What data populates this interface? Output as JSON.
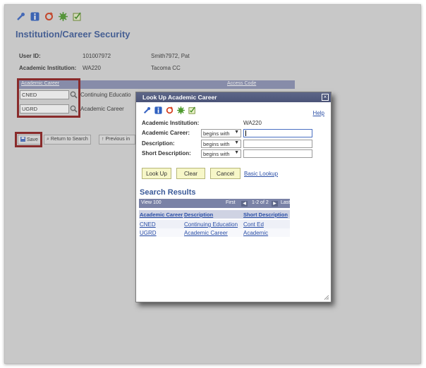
{
  "page": {
    "title": "Institution/Career Security",
    "user_id_label": "User ID:",
    "user_id_value": "101007972",
    "user_name": "Smith7972, Pat",
    "institution_label": "Academic Institution:",
    "institution_value": "WA220",
    "institution_name": "Tacoma CC"
  },
  "grid": {
    "col_academic_career": "Academic Career",
    "col_access_code": "Access Code",
    "rows": [
      {
        "code": "CNED",
        "desc": "Continuing Educatio"
      },
      {
        "code": "UGRD",
        "desc": "Academic Career"
      }
    ]
  },
  "buttons": {
    "save": "Save",
    "return_to_search": "Return to Search",
    "previous": "Previous in"
  },
  "modal": {
    "title": "Look Up Academic Career",
    "help": "Help",
    "institution_label": "Academic Institution:",
    "institution_value": "WA220",
    "career_label": "Academic Career:",
    "description_label": "Description:",
    "short_description_label": "Short Description:",
    "operator": "begins with",
    "lookup_button": "Look Up",
    "clear_button": "Clear",
    "cancel_button": "Cancel",
    "basic_lookup": "Basic Lookup",
    "search_results_title": "Search Results",
    "view_100": "View 100",
    "first": "First",
    "page_range": "1-2 of 2",
    "last": "Last",
    "col_career": "Academic Career",
    "col_description": "Description",
    "col_short_description": "Short Description",
    "results": [
      {
        "career": "CNED",
        "description": "Continuing Education",
        "short": "Cont Ed"
      },
      {
        "career": "UGRD",
        "description": "Academic Career",
        "short": "Academic"
      }
    ]
  },
  "colors": {
    "title_blue": "#3b5a99",
    "header_bar": "#8a90b4",
    "highlight_red": "#8d1a1a",
    "button_yellow": "#f7f7c8"
  }
}
